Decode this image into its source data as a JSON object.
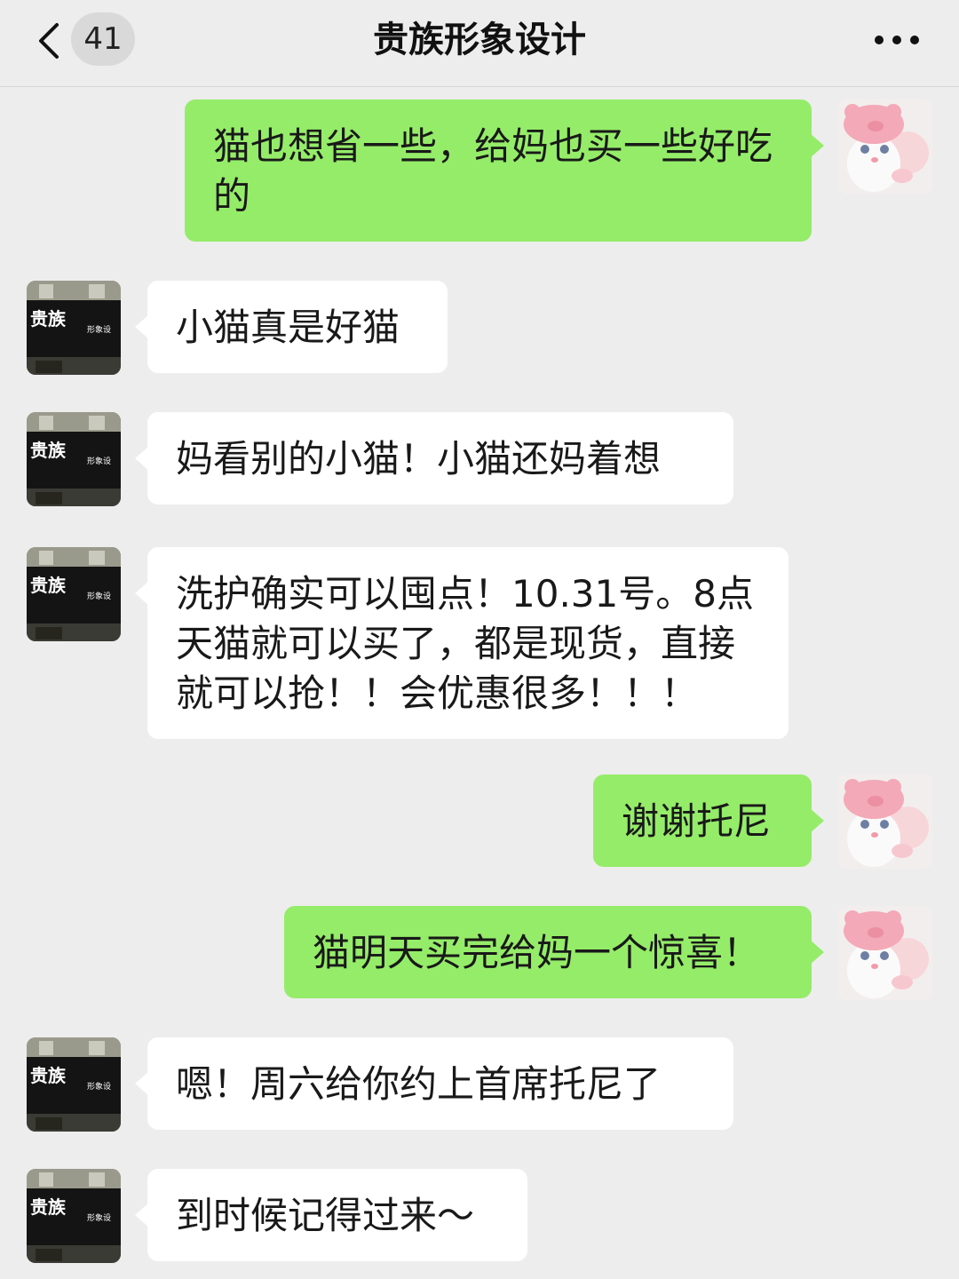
{
  "header": {
    "unread_count": "41",
    "title": "贵族形象设计"
  },
  "colors": {
    "background": "#ededed",
    "incoming_bubble": "#ffffff",
    "outgoing_bubble": "#95ec69"
  },
  "shop_avatar": {
    "sign_text": "贵族",
    "sign_subtext": "形象设"
  },
  "messages": [
    {
      "side": "right",
      "text": "猫也想省一些，给妈也买一些好吃的"
    },
    {
      "side": "left",
      "text": "小猫真是好猫"
    },
    {
      "side": "left",
      "text": "妈看别的小猫！小猫还妈着想"
    },
    {
      "side": "left",
      "text": "洗护确实可以囤点！10.31号。8点天猫就可以买了，都是现货，直接就可以抢！！会优惠很多！！！"
    },
    {
      "side": "right",
      "text": "谢谢托尼"
    },
    {
      "side": "right",
      "text": "猫明天买完给妈一个惊喜！"
    },
    {
      "side": "left",
      "text": "嗯！周六给你约上首席托尼了"
    },
    {
      "side": "left",
      "text": "到时候记得过来～"
    }
  ]
}
